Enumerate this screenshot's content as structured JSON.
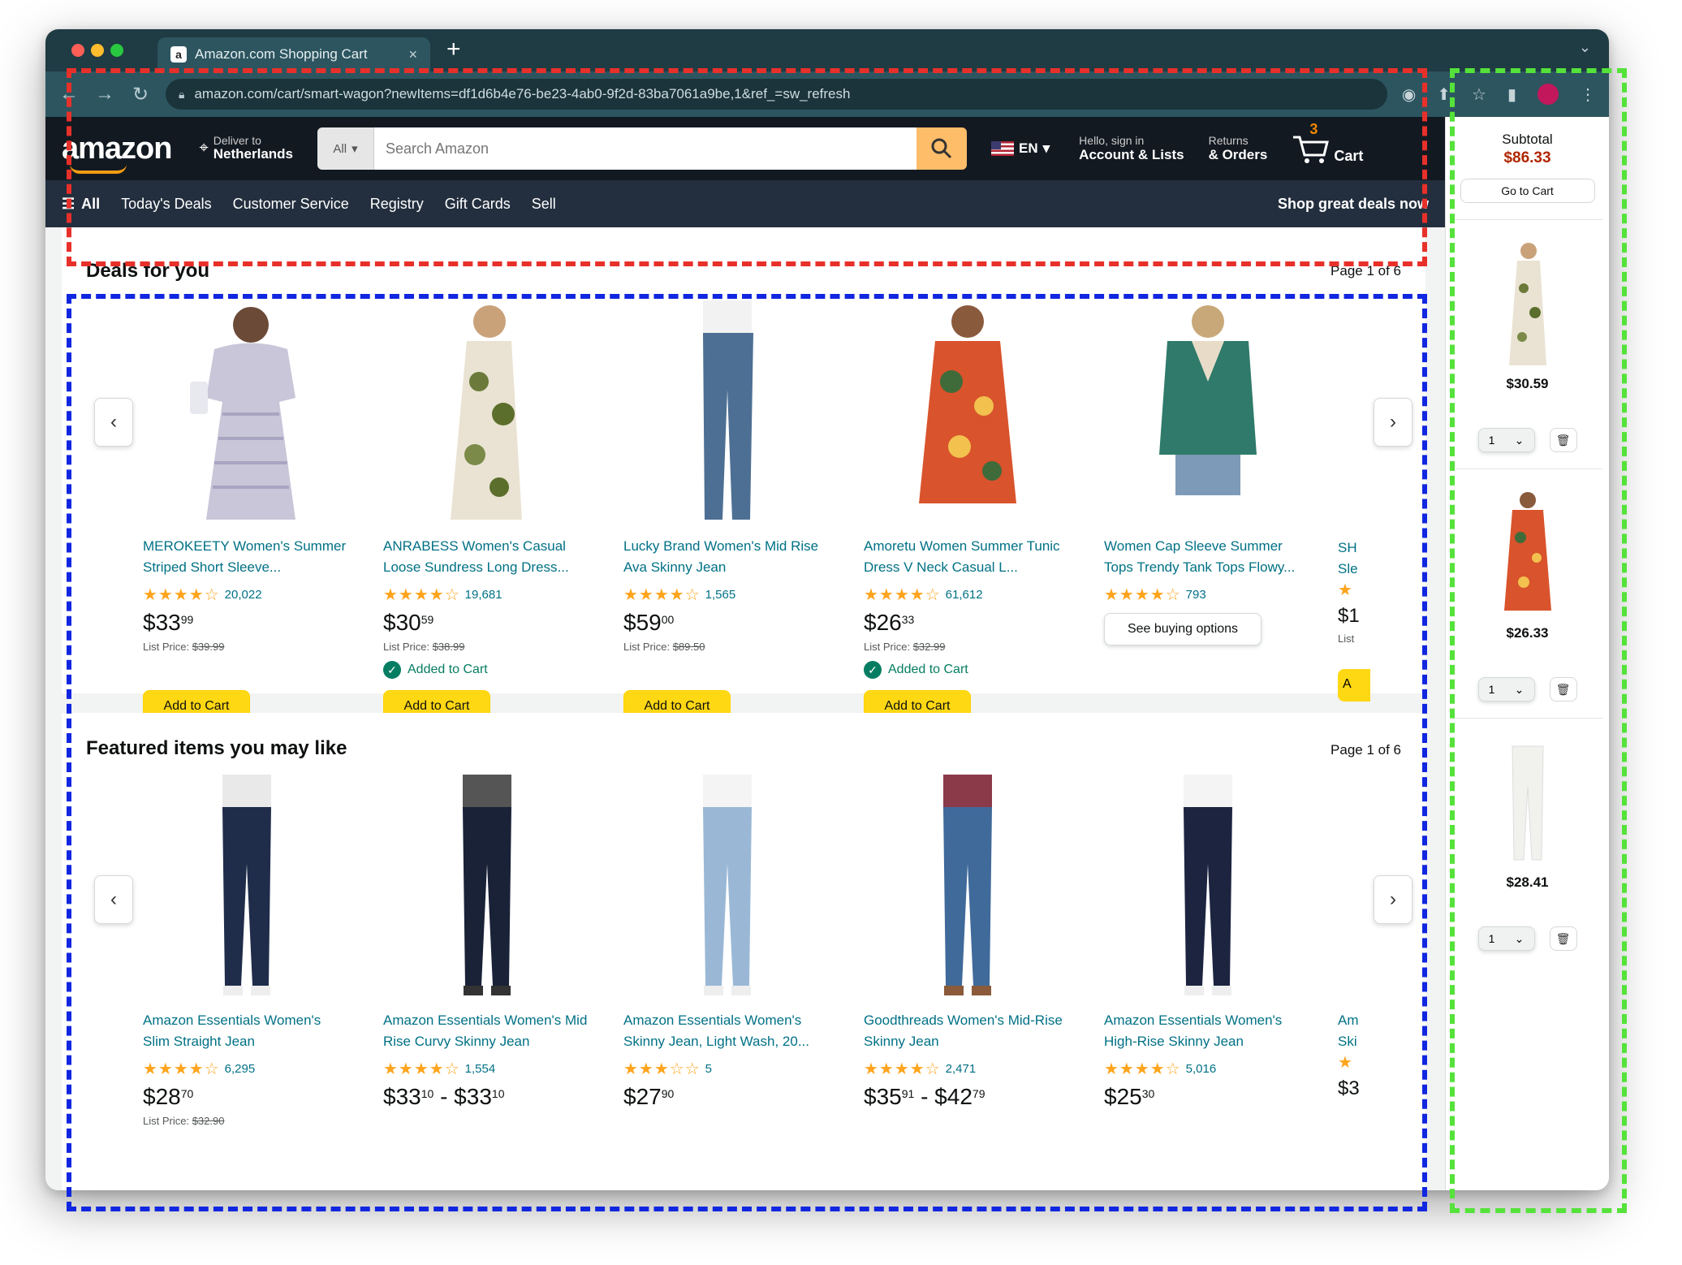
{
  "browser": {
    "tab_title": "Amazon.com Shopping Cart",
    "tab_close": "×",
    "new_tab": "+",
    "tab_menu": "⌄",
    "url": "amazon.com/cart/smart-wagon?newItems=df1d6b4e76-be23-4ab0-9f2d-83ba7061a9be,1&ref_=sw_refresh",
    "favicon_letter": "a"
  },
  "header": {
    "logo_text": "amazon",
    "deliver_line1": "Deliver to",
    "deliver_line2": "Netherlands",
    "search_category": "All",
    "search_placeholder": "Search Amazon",
    "lang": "EN",
    "account_line1": "Hello, sign in",
    "account_line2": "Account & Lists",
    "orders_line1": "Returns",
    "orders_line2": "& Orders",
    "cart_count": "3",
    "cart_label": "Cart"
  },
  "subnav": {
    "all": "All",
    "items": [
      "Today's Deals",
      "Customer Service",
      "Registry",
      "Gift Cards",
      "Sell"
    ],
    "promo": "Shop great deals now"
  },
  "deals": {
    "title": "Deals for you",
    "page": "Page 1 of 6",
    "cards": [
      {
        "title": "MEROKEETY Women's Summer Striped Short Sleeve...",
        "stars": "★★★★☆",
        "reviews": "20,022",
        "price_whole": "$33",
        "price_frac": "99",
        "list_label": "List Price:",
        "list_price": "$39.99",
        "added": "",
        "button": "Add to Cart"
      },
      {
        "title": "ANRABESS Women's Casual Loose Sundress Long Dress...",
        "stars": "★★★★☆",
        "reviews": "19,681",
        "price_whole": "$30",
        "price_frac": "59",
        "list_label": "List Price:",
        "list_price": "$38.99",
        "added": "Added to Cart",
        "button": "Add to Cart"
      },
      {
        "title": "Lucky Brand Women's Mid Rise Ava Skinny Jean",
        "stars": "★★★★☆",
        "reviews": "1,565",
        "price_whole": "$59",
        "price_frac": "00",
        "list_label": "List Price:",
        "list_price": "$89.50",
        "added": "",
        "button": "Add to Cart"
      },
      {
        "title": "Amoretu Women Summer Tunic Dress V Neck Casual L...",
        "stars": "★★★★☆",
        "reviews": "61,612",
        "price_whole": "$26",
        "price_frac": "33",
        "list_label": "List Price:",
        "list_price": "$32.99",
        "added": "Added to Cart",
        "button": "Add to Cart"
      },
      {
        "title": "Women Cap Sleeve Summer Tops Trendy Tank Tops Flowy...",
        "stars": "★★★★☆",
        "reviews": "793",
        "price_whole": "",
        "price_frac": "",
        "list_label": "",
        "list_price": "",
        "added": "",
        "button": "See buying options"
      }
    ],
    "partial": {
      "title": "SH Sle",
      "stars": "★",
      "price": "$1",
      "list": "List",
      "button": "A"
    }
  },
  "featured": {
    "title": "Featured items you may like",
    "page": "Page 1 of 6",
    "cards": [
      {
        "title": "Amazon Essentials Women's Slim Straight Jean",
        "stars": "★★★★☆",
        "reviews": "6,295",
        "price_whole": "$28",
        "price_frac": "70",
        "list_label": "List Price:",
        "list_price": "$32.90"
      },
      {
        "title": "Amazon Essentials Women's Mid Rise Curvy Skinny Jean",
        "stars": "★★★★☆",
        "reviews": "1,554",
        "price_whole": "$33",
        "price_frac": "10",
        "price_extra": " - $33",
        "price_extra_frac": "10"
      },
      {
        "title": "Amazon Essentials Women's Skinny Jean, Light Wash, 20...",
        "stars": "★★★☆☆",
        "reviews": "5",
        "price_whole": "$27",
        "price_frac": "90"
      },
      {
        "title": "Goodthreads Women's Mid-Rise Skinny Jean",
        "stars": "★★★★☆",
        "reviews": "2,471",
        "price_whole": "$35",
        "price_frac": "91",
        "price_extra": " - $42",
        "price_extra_frac": "79"
      },
      {
        "title": "Amazon Essentials Women's High-Rise Skinny Jean",
        "stars": "★★★★☆",
        "reviews": "5,016",
        "price_whole": "$25",
        "price_frac": "30"
      }
    ],
    "partial": {
      "title": "Am Ski",
      "stars": "★",
      "price": "$3"
    }
  },
  "sidebar": {
    "subtotal_label": "Subtotal",
    "subtotal_value": "$86.33",
    "goto_cart": "Go to Cart",
    "items": [
      {
        "price": "$30.59",
        "qty": "1"
      },
      {
        "price": "$26.33",
        "qty": "1"
      },
      {
        "price": "$28.41",
        "qty": "1"
      }
    ]
  },
  "colors": {
    "annotation_red": "#e8302a",
    "annotation_blue": "#1126e0",
    "annotation_green": "#55e23a",
    "amazon_dark": "#131921",
    "amazon_nav": "#232f3e",
    "add_to_cart": "#ffd814",
    "link_teal": "#007185",
    "star_orange": "#ffa41c"
  }
}
